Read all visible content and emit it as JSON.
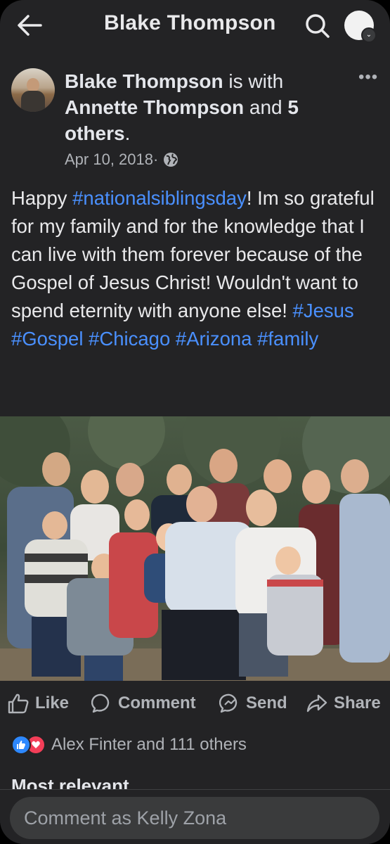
{
  "header": {
    "title": "Blake Thompson"
  },
  "post": {
    "author": "Blake Thompson",
    "is_with": " is with",
    "tagged": "Annette Thompson",
    "and": " and ",
    "others_count": "5",
    "others_word": "others",
    "date": "Apr 10, 2018",
    "separator": " · ",
    "privacy_icon": "globe-icon",
    "text": {
      "happy": "Happy ",
      "tag1": "#nationalsiblingsday",
      "body": "! Im so grateful for my family and for the knowledge that I can live with them forever because of the Gospel of Jesus Christ! Wouldn't want to spend eternity with anyone else!",
      "tags": [
        "#Jesus",
        "#Gospel",
        "#Chicago",
        "#Arizona",
        "#family"
      ]
    }
  },
  "actions": {
    "like": "Like",
    "comment": "Comment",
    "send": "Send",
    "share": "Share"
  },
  "reactions": {
    "text": "Alex Finter and 111 others"
  },
  "comments": {
    "sort_label": "Most relevant",
    "input_placeholder": "Comment as Kelly Zona"
  },
  "colors": {
    "background": "#232325",
    "hashtag": "#4a90ff",
    "like_blue": "#2d88ff",
    "love_red": "#f33e58"
  }
}
